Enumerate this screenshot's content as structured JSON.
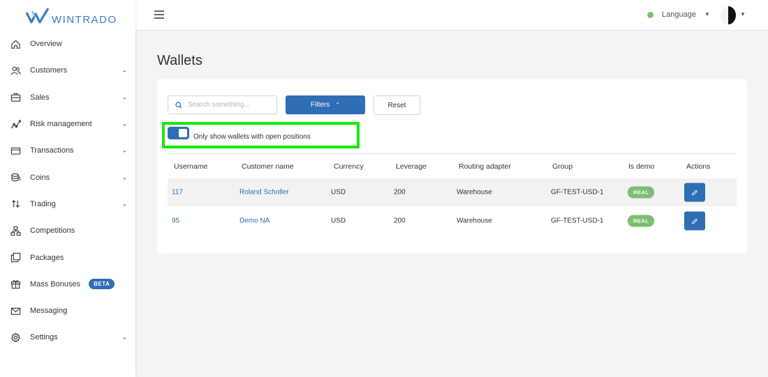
{
  "brand": {
    "name": "WINTRADO",
    "accent": "#2f6db5",
    "highlight": "#19e80e",
    "success": "#7cbf73"
  },
  "sidebar": {
    "items": [
      {
        "label": "Overview",
        "icon": "home-icon",
        "chevron": false
      },
      {
        "label": "Customers",
        "icon": "users-icon",
        "chevron": true
      },
      {
        "label": "Sales",
        "icon": "briefcase-icon",
        "chevron": true
      },
      {
        "label": "Risk management",
        "icon": "chart-line-icon",
        "chevron": true
      },
      {
        "label": "Transactions",
        "icon": "credit-card-icon",
        "chevron": true
      },
      {
        "label": "Coins",
        "icon": "coins-icon",
        "chevron": true
      },
      {
        "label": "Trading",
        "icon": "arrows-updown-icon",
        "chevron": true
      },
      {
        "label": "Competitions",
        "icon": "hierarchy-icon",
        "chevron": false
      },
      {
        "label": "Packages",
        "icon": "copy-icon",
        "chevron": false
      },
      {
        "label": "Mass Bonuses",
        "icon": "gift-icon",
        "chevron": false,
        "badge": "BETA"
      },
      {
        "label": "Messaging",
        "icon": "mail-icon",
        "chevron": false
      },
      {
        "label": "Settings",
        "icon": "gear-icon",
        "chevron": true
      }
    ]
  },
  "topbar": {
    "language_label": "Language"
  },
  "page": {
    "title": "Wallets"
  },
  "toolbar": {
    "search_placeholder": "Search something...",
    "filters_label": "Filters",
    "reset_label": "Reset",
    "toggle_label": "Only show wallets with open positions",
    "toggle_on": true
  },
  "table": {
    "headers": [
      "Username",
      "Customer name",
      "Currency",
      "Leverage",
      "Routing adapter",
      "Group",
      "Is demo",
      "Actions"
    ],
    "rows": [
      {
        "username": "117",
        "customer_name": "Roland Scholler",
        "currency": "USD",
        "leverage": "200",
        "routing_adapter": "Warehouse",
        "group": "GF-TEST-USD-1",
        "is_demo": "REAL"
      },
      {
        "username": "95",
        "customer_name": "Demo NA",
        "currency": "USD",
        "leverage": "200",
        "routing_adapter": "Warehouse",
        "group": "GF-TEST-USD-1",
        "is_demo": "REAL"
      }
    ]
  }
}
